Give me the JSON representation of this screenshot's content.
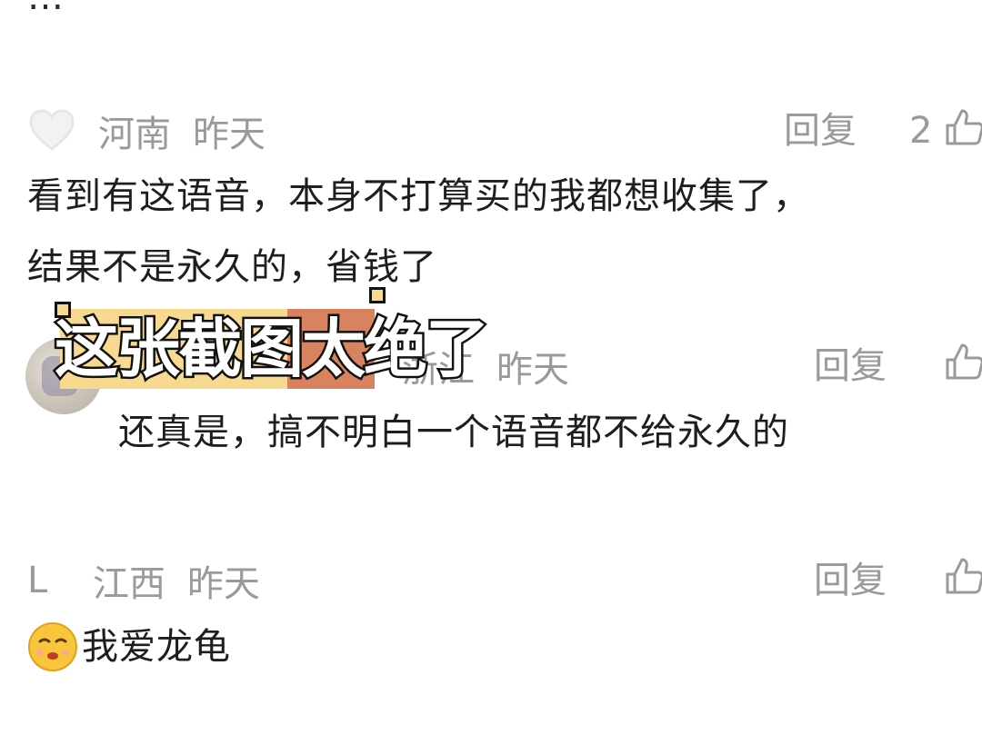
{
  "top_partial_text": "…",
  "comments": [
    {
      "region": "河南",
      "time": "昨天",
      "reply_label": "回复",
      "like_count": "2",
      "text_line1": "看到有这语音，本身不打算买的我都想收集了，",
      "text_line2": "结果不是永久的，省钱了"
    },
    {
      "region": "浙江",
      "time": "昨天",
      "reply_label": "回复",
      "text": "还真是，搞不明白一个语音都不给永久的"
    },
    {
      "initial": "L",
      "region": "江西",
      "time": "昨天",
      "reply_label": "回复",
      "text": "我爱龙龟"
    }
  ],
  "banner": {
    "text": "这张截图太绝了",
    "colors": {
      "left": "#f7d98f",
      "right": "#d9825f",
      "outline": "#111111"
    }
  },
  "icons": {
    "heart": "heart-outline-icon",
    "like": "thumbs-up-icon",
    "emoji": "shushing-face-emoji"
  },
  "colors": {
    "meta_text": "#9a9a9a",
    "body_text": "#1e1e1e",
    "background": "#ffffff"
  }
}
